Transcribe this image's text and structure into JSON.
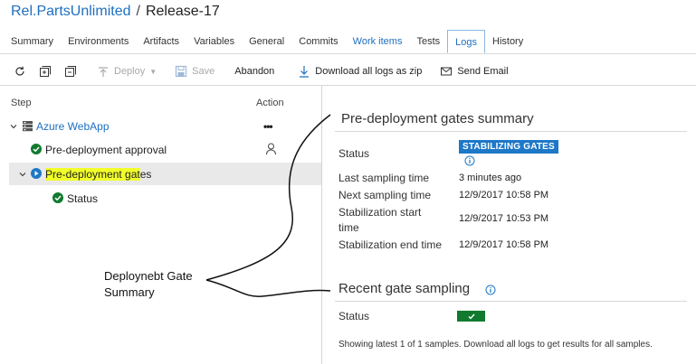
{
  "breadcrumb": {
    "root": "Rel.PartsUnlimited",
    "separator": "/",
    "current": "Release-17"
  },
  "tabs": [
    {
      "label": "Summary"
    },
    {
      "label": "Environments"
    },
    {
      "label": "Artifacts"
    },
    {
      "label": "Variables"
    },
    {
      "label": "General"
    },
    {
      "label": "Commits"
    },
    {
      "label": "Work items"
    },
    {
      "label": "Tests"
    },
    {
      "label": "Logs"
    },
    {
      "label": "History"
    }
  ],
  "toolbar": {
    "deploy_label": "Deploy",
    "save_label": "Save",
    "abandon_label": "Abandon",
    "download_label": "Download all logs as zip",
    "email_label": "Send Email"
  },
  "tree": {
    "step_header": "Step",
    "action_header": "Action",
    "environment": "Azure WebApp",
    "environment_action": "•••",
    "approval": "Pre-deployment approval",
    "gates_highlighted": "Pre-deployment gat",
    "gates_rest": "es",
    "status": "Status"
  },
  "summary": {
    "title": "Pre-deployment gates summary",
    "status_label": "Status",
    "status_badge": "STABILIZING GATES",
    "last_sampling_label": "Last sampling time",
    "last_sampling_value": "3 minutes ago",
    "next_sampling_label": "Next sampling time",
    "next_sampling_value": "12/9/2017 10:58 PM",
    "stab_start_label_1": "Stabilization start",
    "stab_start_label_2": "time",
    "stab_start_value": "12/9/2017 10:53 PM",
    "stab_end_label": "Stabilization end time",
    "stab_end_value": "12/9/2017 10:58 PM"
  },
  "recent": {
    "title": "Recent gate sampling",
    "status_label": "Status",
    "footnote": "Showing latest 1 of 1 samples. Download all logs to get results for all samples."
  },
  "annotation": {
    "line1": "Deploynebt Gate",
    "line2": "Summary"
  },
  "colors": {
    "link": "#1e6fc1",
    "badge": "#1e78c7",
    "success": "#117a2f",
    "highlight": "#f2ff2a"
  }
}
